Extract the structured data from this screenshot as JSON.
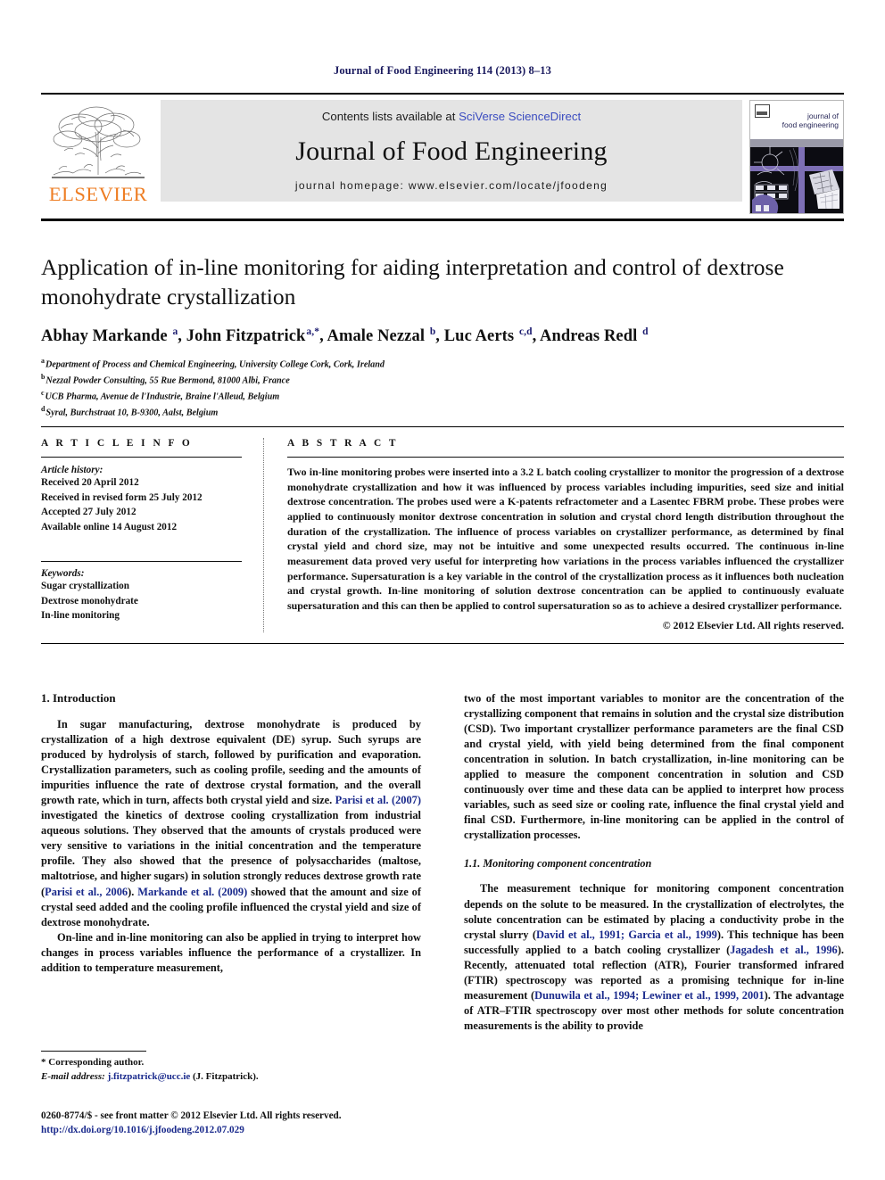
{
  "running_head": "Journal of Food Engineering 114 (2013) 8–13",
  "masthead": {
    "elsevier_wordmark": "ELSEVIER",
    "contents_prefix": "Contents lists available at ",
    "contents_link": "SciVerse ScienceDirect",
    "journal_title": "Journal of Food Engineering",
    "homepage": "journal homepage: www.elsevier.com/locate/jfoodeng",
    "cover_title_line1": "journal of",
    "cover_title_line2": "food engineering"
  },
  "article": {
    "title": "Application of in-line monitoring for aiding interpretation and control of dextrose monohydrate crystallization",
    "authors_html": "Abhay Markande <sup>a</sup>, John Fitzpatrick<sup>a,*</sup>, Amale Nezzal <sup>b</sup>, Luc Aerts <sup>c,d</sup>, Andreas Redl <sup>d</sup>",
    "affiliations": [
      {
        "marker": "a",
        "text": "Department of Process and Chemical Engineering, University College Cork, Cork, Ireland"
      },
      {
        "marker": "b",
        "text": "Nezzal Powder Consulting, 55 Rue Bermond, 81000 Albi, France"
      },
      {
        "marker": "c",
        "text": "UCB Pharma, Avenue de l'Industrie, Braine l'Alleud, Belgium"
      },
      {
        "marker": "d",
        "text": "Syral, Burchstraat 10, B-9300, Aalst, Belgium"
      }
    ]
  },
  "article_info": {
    "heading": "A R T I C L E   I N F O",
    "history_label": "Article history:",
    "history": [
      "Received 20 April 2012",
      "Received in revised form 25 July 2012",
      "Accepted 27 July 2012",
      "Available online 14 August 2012"
    ],
    "keywords_label": "Keywords:",
    "keywords": [
      "Sugar crystallization",
      "Dextrose monohydrate",
      "In-line monitoring"
    ]
  },
  "abstract": {
    "heading": "A B S T R A C T",
    "text": "Two in-line monitoring probes were inserted into a 3.2 L batch cooling crystallizer to monitor the progression of a dextrose monohydrate crystallization and how it was influenced by process variables including impurities, seed size and initial dextrose concentration. The probes used were a K-patents refractometer and a Lasentec FBRM probe. These probes were applied to continuously monitor dextrose concentration in solution and crystal chord length distribution throughout the duration of the crystallization. The influence of process variables on crystallizer performance, as determined by final crystal yield and chord size, may not be intuitive and some unexpected results occurred. The continuous in-line measurement data proved very useful for interpreting how variations in the process variables influenced the crystallizer performance. Supersaturation is a key variable in the control of the crystallization process as it influences both nucleation and crystal growth. In-line monitoring of solution dextrose concentration can be applied to continuously evaluate supersaturation and this can then be applied to control supersaturation so as to achieve a desired crystallizer performance.",
    "copyright": "© 2012 Elsevier Ltd. All rights reserved."
  },
  "body": {
    "section_1_title": "1. Introduction",
    "left_para_1_pre": "In sugar manufacturing, dextrose monohydrate is produced by crystallization of a high dextrose equivalent (DE) syrup. Such syrups are produced by hydrolysis of starch, followed by purification and evaporation. Crystallization parameters, such as cooling profile, seeding and the amounts of impurities influence the rate of dextrose crystal formation, and the overall growth rate, which in turn, affects both crystal yield and size. ",
    "cite_parisi_2007": "Parisi et al. (2007)",
    "left_para_1_mid": " investigated the kinetics of dextrose cooling crystallization from industrial aqueous solutions. They observed that the amounts of crystals produced were very sensitive to variations in the initial concentration and the temperature profile. They also showed that the presence of polysaccharides (maltose, maltotriose, and higher sugars) in solution strongly reduces dextrose growth rate (",
    "cite_parisi_2006": "Parisi et al., 2006",
    "left_para_1_mid2": "). ",
    "cite_markande_2009": "Markande et al. (2009)",
    "left_para_1_end": " showed that the amount and size of crystal seed added and the cooling profile influenced the crystal yield and size of dextrose monohydrate.",
    "left_para_2": "On-line and in-line monitoring can also be applied in trying to interpret how changes in process variables influence the performance of a crystallizer. In addition to temperature measurement,",
    "right_para_1": "two of the most important variables to monitor are the concentration of the crystallizing component that remains in solution and the crystal size distribution (CSD). Two important crystallizer performance parameters are the final CSD and crystal yield, with yield being determined from the final component concentration in solution. In batch crystallization, in-line monitoring can be applied to measure the component concentration in solution and CSD continuously over time and these data can be applied to interpret how process variables, such as seed size or cooling rate, influence the final crystal yield and final CSD. Furthermore, in-line monitoring can be applied in the control of crystallization processes.",
    "subsection_1_1_title": "1.1. Monitoring component concentration",
    "right_para_2_pre": "The measurement technique for monitoring component concentration depends on the solute to be measured. In the crystallization of electrolytes, the solute concentration can be estimated by placing a conductivity probe in the crystal slurry (",
    "cite_david_garcia": "David et al., 1991; Garcia et al., 1999",
    "right_para_2_mid": "). This technique has been successfully applied to a batch cooling crystallizer (",
    "cite_jagadesh": "Jagadesh et al., 1996",
    "right_para_2_mid2": "). Recently, attenuated total reflection (ATR), Fourier transformed infrared (FTIR) spectroscopy was reported as a promising technique for in-line measurement (",
    "cite_dunuwila_lewiner": "Dunuwila et al., 1994; Lewiner et al., 1999, 2001",
    "right_para_2_end": "). The advantage of ATR–FTIR spectroscopy over most other methods for solute concentration measurements is the ability to provide"
  },
  "footnote": {
    "corresponding": "* Corresponding author.",
    "email_label": "E-mail address: ",
    "email": "j.fitzpatrick@ucc.ie",
    "email_suffix": " (J. Fitzpatrick)."
  },
  "imprint": {
    "issn_line": "0260-8774/$ - see front matter © 2012 Elsevier Ltd. All rights reserved.",
    "doi": "http://dx.doi.org/10.1016/j.jfoodeng.2012.07.029"
  },
  "colors": {
    "running_head": "#1a1a5e",
    "link_blue": "#1a2a8c",
    "sciencedirect_blue": "#3b4cc0",
    "elsevier_orange": "#ee7d23",
    "contents_bg": "#e4e4e4"
  }
}
